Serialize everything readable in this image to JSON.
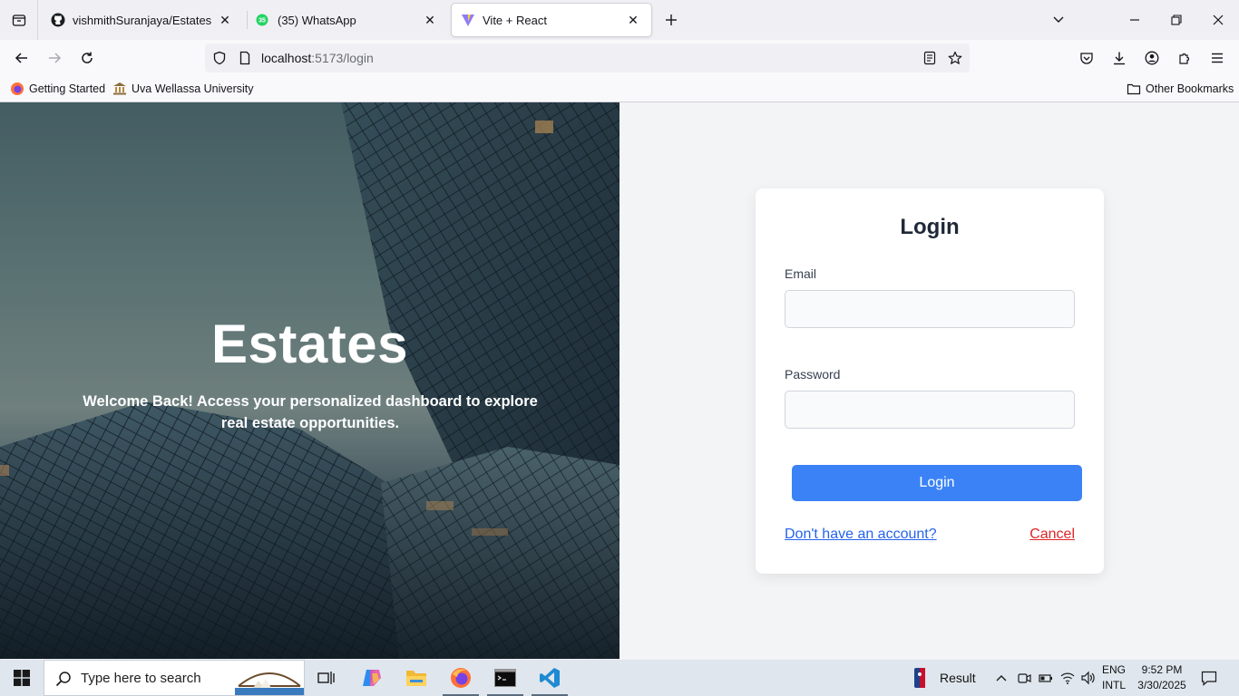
{
  "browser": {
    "tabs": [
      {
        "title": "vishmithSuranjaya/Estates",
        "icon": "github-icon"
      },
      {
        "title": "(35) WhatsApp",
        "icon": "whatsapp-icon",
        "badge": "35"
      },
      {
        "title": "Vite + React",
        "icon": "vite-icon",
        "active": true
      }
    ],
    "url_host": "localhost",
    "url_rest": ":5173/login",
    "bookmarks": [
      {
        "label": "Getting Started",
        "icon": "firefox-icon"
      },
      {
        "label": "Uva Wellassa University",
        "icon": "university-icon"
      }
    ],
    "other_bookmarks": "Other Bookmarks"
  },
  "hero": {
    "title": "Estates",
    "subtitle": "Welcome Back! Access your personalized dashboard to explore real estate opportunities."
  },
  "login": {
    "title": "Login",
    "email_label": "Email",
    "email_value": "",
    "password_label": "Password",
    "password_value": "",
    "submit_label": "Login",
    "signup_link": "Don't have an account?",
    "cancel_link": "Cancel"
  },
  "taskbar": {
    "search_placeholder": "Type here to search",
    "tray_result": "Result",
    "lang_1": "ENG",
    "lang_2": "INTL",
    "time": "9:52 PM",
    "date": "3/30/2025"
  },
  "colors": {
    "primary": "#3b82f6",
    "link": "#2563eb",
    "cancel": "#dc2626"
  }
}
